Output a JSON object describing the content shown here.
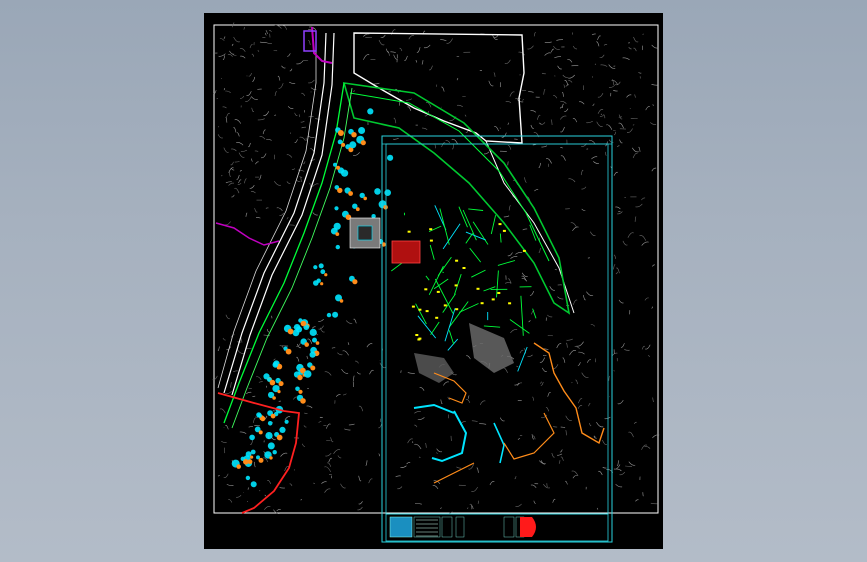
{
  "viewer": {
    "background_top": "#9aa7b7",
    "background_bottom": "#b3bcc8"
  },
  "drawing": {
    "background": "#000000",
    "border_color": "#ffffff",
    "road_color": "#ffffff",
    "contour_color": "#8a8a8a",
    "building_color": "#00e5ff",
    "building_accent": "#ff8c1a",
    "pipe_color": "#00ff3a",
    "boundary_color": "#c000c0",
    "red_boundary": "#ff2020",
    "orange_path": "#ff8c1a",
    "cyan_frame": "#2ad4e0",
    "title_block_red": "#ff1a1a"
  }
}
